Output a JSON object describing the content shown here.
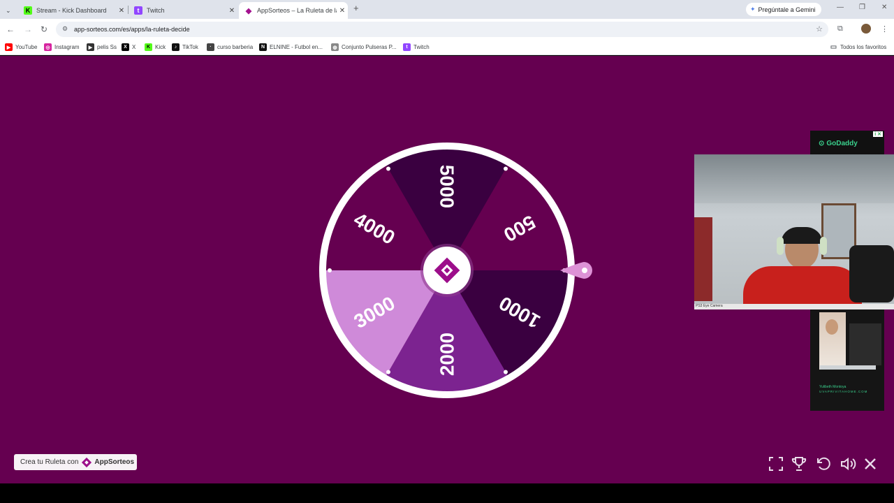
{
  "browser": {
    "tabs": [
      {
        "title": "Stream - Kick Dashboard",
        "favicon": "kick-icon",
        "active": false
      },
      {
        "title": "Twitch",
        "favicon": "twitch-icon",
        "active": false
      },
      {
        "title": "AppSorteos – La Ruleta de la Su",
        "favicon": "appsorteos-icon",
        "active": true
      }
    ],
    "gemini_label": "Pregúntale a Gemini",
    "url": "app-sorteos.com/es/apps/la-ruleta-decide",
    "bookmarks": [
      "YouTube",
      "Instagram",
      "pelis Ss",
      "X",
      "Kick",
      "TikTok",
      "curso barberia",
      "ELNINE - Futbol en...",
      "Conjunto Pulseras P...",
      "Twitch"
    ],
    "all_bookmarks_label": "Todos los favoritos"
  },
  "page": {
    "background": "#650050",
    "wheel": {
      "segments": [
        {
          "label": "5000",
          "color": "#3a0040"
        },
        {
          "label": "500",
          "color": "#650050"
        },
        {
          "label": "1000",
          "color": "#3a0040"
        },
        {
          "label": "2000",
          "color": "#7c2390"
        },
        {
          "label": "3000",
          "color": "#cf8ad9"
        },
        {
          "label": "4000",
          "color": "#650050"
        }
      ],
      "pointer_color": "#dd92d6"
    },
    "cta_text": "Crea tu Ruleta con",
    "cta_brand": "AppSorteos",
    "controls": [
      "fullscreen-icon",
      "trophy-icon",
      "reset-icon",
      "volume-icon",
      "close-icon"
    ]
  },
  "overlay": {
    "ad_top_brand": "GoDaddy",
    "ad_bottom_name": "Yulibeth Montoya",
    "ad_bottom_site": "UVAPRIVITAHOME.COM",
    "camera_caption": "PS3 Eye Camera"
  }
}
